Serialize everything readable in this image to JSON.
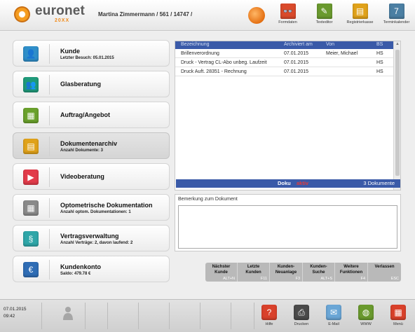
{
  "header": {
    "logo_word": "euronet",
    "logo_sub": "20XX",
    "user_info": "Martina Zimmermann / 561 / 14747 /",
    "tools": [
      {
        "label": "Formdaten",
        "icon": "glasses-icon",
        "color": "#d94a2b",
        "glyph": "👓"
      },
      {
        "label": "Texteditor",
        "icon": "pencil-icon",
        "color": "#6a9a2e",
        "glyph": "✎"
      },
      {
        "label": "Registrierkasse",
        "icon": "cash-register-icon",
        "color": "#e0a21a",
        "glyph": "▤"
      },
      {
        "label": "Terminkalender",
        "icon": "calendar-icon",
        "color": "#4b7fa3",
        "glyph": "7"
      }
    ]
  },
  "nav": [
    {
      "title": "Kunde",
      "sub": "Letzter Besuch: 05.01.2015",
      "icon": "customer-icon",
      "color": "#2f8ec9",
      "glyph": "👤",
      "active": false
    },
    {
      "title": "Glasberatung",
      "sub": "",
      "icon": "consultation-icon",
      "color": "#1f9a7a",
      "glyph": "👥",
      "active": false
    },
    {
      "title": "Auftrag/Angebot",
      "sub": "",
      "icon": "order-icon",
      "color": "#6aa12c",
      "glyph": "▦",
      "active": false
    },
    {
      "title": "Dokumentenarchiv",
      "sub": "Anzahl Dokumente: 3",
      "icon": "archive-icon",
      "color": "#e0a21a",
      "glyph": "▤",
      "active": true
    },
    {
      "title": "Videoberatung",
      "sub": "",
      "icon": "video-icon",
      "color": "#e23b4a",
      "glyph": "▶",
      "active": false
    },
    {
      "title": "Optometrische Dokumentation",
      "sub": "Anzahl optom. Dokumentationen: 1",
      "icon": "eye-chart-icon",
      "color": "#8a8a8a",
      "glyph": "▦",
      "active": false
    },
    {
      "title": "Vertragsverwaltung",
      "sub": "Anzahl Verträge: 2, davon laufend: 2",
      "icon": "contract-icon",
      "color": "#2fa6a8",
      "glyph": "§",
      "active": false
    },
    {
      "title": "Kundenkonto",
      "sub": "Saldo: 479.78 €",
      "icon": "account-icon",
      "color": "#2f6db5",
      "glyph": "€",
      "active": false
    }
  ],
  "documents": {
    "columns": [
      "Bezeichnung",
      "Archiviert am",
      "Von",
      "BS"
    ],
    "rows": [
      [
        "Brillenverordnung",
        "07.01.2015",
        "Meier, Michael",
        "HS"
      ],
      [
        "Druck - Vertrag CL-Abo unbeg. Laufzeit",
        "07.01.2015",
        "",
        "HS"
      ],
      [
        "Druck Auft. 28351 - Rechnung",
        "07.01.2015",
        "",
        "HS"
      ]
    ],
    "status_title": "Doku",
    "status_flag": "aktiv",
    "status_count": "3 Dokumente"
  },
  "remarks": {
    "label": "Bemerkung zum Dokument",
    "value": ""
  },
  "function_keys": [
    {
      "label": "Nächster Kunde",
      "key": "ALT+N"
    },
    {
      "label": "Letzte Kunden",
      "key": "F11"
    },
    {
      "label": "Kunden-Neuanlage",
      "key": "F3"
    },
    {
      "label": "Kunden-Suche",
      "key": "ALT+S"
    },
    {
      "label": "Weitere Funktionen",
      "key": "F4"
    },
    {
      "label": "Verlassen",
      "key": "ESC"
    }
  ],
  "footer": {
    "date": "07.01.2015",
    "time": "09:42",
    "tools": [
      {
        "label": "Hilfe",
        "icon": "help-icon",
        "color": "#d9412b",
        "glyph": "?"
      },
      {
        "label": "Drucken",
        "icon": "printer-icon",
        "color": "#4a4a4a",
        "glyph": "⎙"
      },
      {
        "label": "E-Mail",
        "icon": "mail-icon",
        "color": "#6aa6d6",
        "glyph": "✉"
      },
      {
        "label": "WWW",
        "icon": "globe-icon",
        "color": "#6a9a2e",
        "glyph": "◍"
      },
      {
        "label": "Menü",
        "icon": "menu-grid-icon",
        "color": "#d9412b",
        "glyph": "▦"
      }
    ]
  }
}
